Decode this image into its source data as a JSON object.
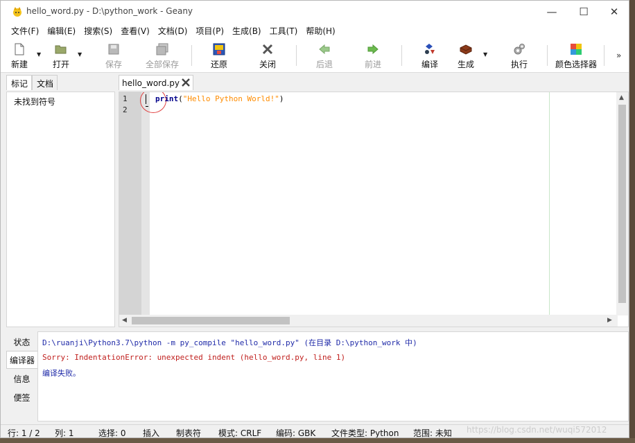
{
  "window": {
    "title": "hello_word.py - D:\\python_work - Geany",
    "icon": "geany-icon",
    "controls": {
      "minimize": "—",
      "maximize": "☐",
      "close": "✕"
    }
  },
  "menu": {
    "items": [
      "文件(F)",
      "编辑(E)",
      "搜索(S)",
      "查看(V)",
      "文档(D)",
      "项目(P)",
      "生成(B)",
      "工具(T)",
      "帮助(H)"
    ]
  },
  "toolbar": {
    "new": "新建",
    "open": "打开",
    "save": "保存",
    "save_all": "全部保存",
    "revert": "还原",
    "close": "关闭",
    "back": "后退",
    "forward": "前进",
    "compile": "编译",
    "build": "生成",
    "execute": "执行",
    "color_picker": "颜色选择器",
    "more": "»"
  },
  "sidebar": {
    "tabs": [
      "标记",
      "文档"
    ],
    "active_tab": "标记",
    "content": "未找到符号"
  },
  "editor": {
    "tab_label": "hello_word.py",
    "line_numbers": [
      "1",
      "2"
    ],
    "code": {
      "keyword": "print",
      "open_paren": "(",
      "string": "\"Hello Python World!\"",
      "close_paren": ")"
    }
  },
  "messages": {
    "tabs": [
      "状态",
      "编译器",
      "信息",
      "便签"
    ],
    "active_tab": "编译器",
    "lines": [
      "D:\\ruanji\\Python3.7\\python -m py_compile \"hello_word.py\" (在目录 D:\\python_work 中)",
      "Sorry: IndentationError: unexpected indent (hello_word.py, line 1)",
      "编译失败。"
    ]
  },
  "statusbar": {
    "line": "行: 1 / 2",
    "col": "列: 1",
    "sel": "选择: 0",
    "mode": "插入",
    "indent": "制表符",
    "eol": "模式: CRLF",
    "encoding": "编码: GBK",
    "filetype": "文件类型: Python",
    "scope": "范围: 未知"
  },
  "watermark": "https://blog.csdn.net/wuqi572012",
  "colors": {
    "keyword": "#00008b",
    "string": "#ff8c00",
    "error": "#c0201e",
    "info": "#1f2aa8"
  }
}
